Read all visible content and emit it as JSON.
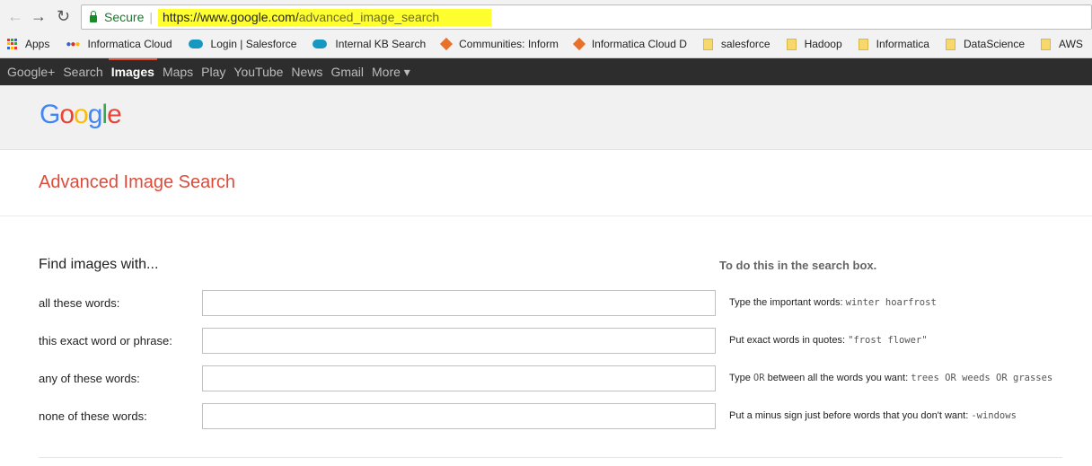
{
  "browser": {
    "secure_label": "Secure",
    "url_host": "https://www.google.com/",
    "url_path": "advanced_image_search"
  },
  "bookmarks": [
    {
      "label": "Apps",
      "icon": "apps-grid-icon"
    },
    {
      "label": "Informatica Cloud",
      "icon": "informatica-dots-icon"
    },
    {
      "label": "Login | Salesforce",
      "icon": "salesforce-icon"
    },
    {
      "label": "Internal KB Search",
      "icon": "salesforce-icon"
    },
    {
      "label": "Communities: Inform",
      "icon": "informatica-icon"
    },
    {
      "label": "Informatica Cloud D",
      "icon": "informatica-icon"
    },
    {
      "label": "salesforce",
      "icon": "folder-icon"
    },
    {
      "label": "Hadoop",
      "icon": "folder-icon"
    },
    {
      "label": "Informatica",
      "icon": "folder-icon"
    },
    {
      "label": "DataScience",
      "icon": "folder-icon"
    },
    {
      "label": "AWS",
      "icon": "folder-icon"
    }
  ],
  "gbar": [
    "Google+",
    "Search",
    "Images",
    "Maps",
    "Play",
    "YouTube",
    "News",
    "Gmail",
    "More ▾"
  ],
  "logo": "Google",
  "title": "Advanced Image Search",
  "find_heading": "Find images with...",
  "todo_heading": "To do this in the search box.",
  "rows": [
    {
      "label": "all these words:",
      "value": "",
      "hint": "Type the important words: ",
      "code": "winter hoarfrost"
    },
    {
      "label": "this exact word or phrase:",
      "value": "",
      "hint": "Put exact words in quotes: ",
      "code": "\"frost flower\""
    },
    {
      "label": "any of these words:",
      "value": "",
      "hint_a": "Type ",
      "code_a": "OR",
      "hint_b": " between all the words you want: ",
      "code": "trees OR weeds OR grasses"
    },
    {
      "label": "none of these words:",
      "value": "",
      "hint": "Put a minus sign just before words that you don't want: ",
      "code": "-windows"
    }
  ]
}
